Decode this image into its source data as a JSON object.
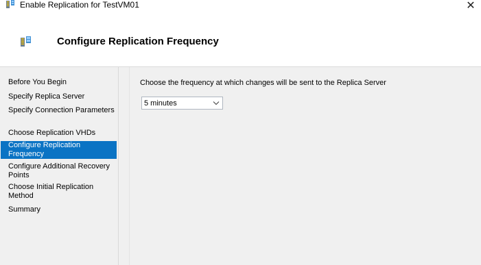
{
  "window": {
    "title": "Enable Replication for TestVM01",
    "close_glyph": "✕",
    "icon": "hyper-v-replica-icon"
  },
  "header": {
    "title": "Configure Replication Frequency",
    "icon": "hyper-v-replica-icon"
  },
  "sidebar": {
    "items": [
      {
        "label": "Before You Begin",
        "active": false
      },
      {
        "label": "Specify Replica Server",
        "active": false
      },
      {
        "label": "Specify Connection Parameters",
        "active": false
      },
      {
        "label": "Choose Replication VHDs",
        "active": false
      },
      {
        "label": "Configure Replication Frequency",
        "active": true
      },
      {
        "label": "Configure Additional Recovery Points",
        "active": false
      },
      {
        "label": "Choose Initial Replication Method",
        "active": false
      },
      {
        "label": "Summary",
        "active": false
      }
    ]
  },
  "main": {
    "instruction": "Choose the frequency at which changes will be sent to the Replica Server",
    "frequency_select": {
      "value": "5 minutes",
      "icon": "chevron-down-icon"
    }
  },
  "colors": {
    "active_item_bg": "#0a73c4",
    "active_item_text": "#ffffff",
    "window_bg": "#f0f0f0",
    "header_bg": "#ffffff"
  }
}
